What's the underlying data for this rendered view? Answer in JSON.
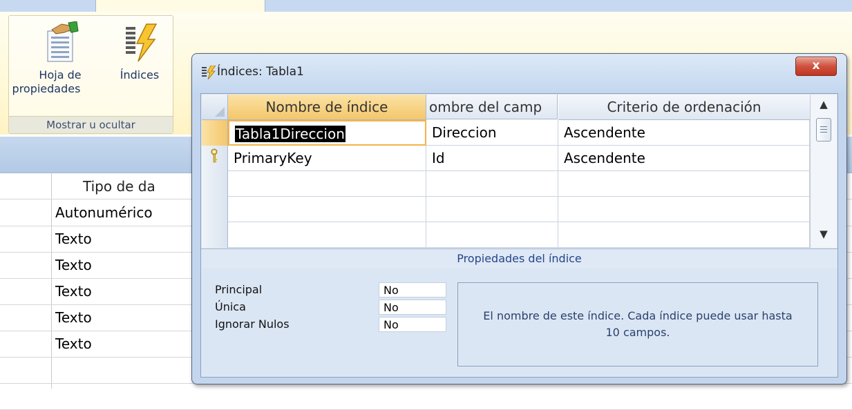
{
  "ribbon": {
    "buttons": [
      {
        "label_line1": "Hoja de",
        "label_line2": "propiedades",
        "icon": "property-sheet-icon"
      },
      {
        "label": "Índices",
        "icon": "indexes-icon"
      }
    ],
    "group_caption": "Mostrar u ocultar"
  },
  "background_table": {
    "column_header": "Tipo de da",
    "rows": [
      "Autonumérico",
      "Texto",
      "Texto",
      "Texto",
      "Texto",
      "Texto",
      "",
      ""
    ]
  },
  "dialog": {
    "title": "Índices: Tabla1",
    "close_label": "x",
    "columns": [
      "Nombre de índice",
      "ombre del camp",
      "Criterio de ordenación"
    ],
    "rows": [
      {
        "index_name": "Tabla1Direccion",
        "field_name": "Direccion",
        "sort_order": "Ascendente",
        "primary_key": false,
        "current": true
      },
      {
        "index_name": "PrimaryKey",
        "field_name": "Id",
        "sort_order": "Ascendente",
        "primary_key": true,
        "current": false
      },
      {
        "index_name": "",
        "field_name": "",
        "sort_order": "",
        "primary_key": false,
        "current": false
      },
      {
        "index_name": "",
        "field_name": "",
        "sort_order": "",
        "primary_key": false,
        "current": false
      },
      {
        "index_name": "",
        "field_name": "",
        "sort_order": "",
        "primary_key": false,
        "current": false
      }
    ],
    "properties_caption": "Propiedades del índice",
    "properties": [
      {
        "label": "Principal",
        "value": "No"
      },
      {
        "label": "Única",
        "value": "No"
      },
      {
        "label": "Ignorar Nulos",
        "value": "No"
      }
    ],
    "help_text": "El nombre de este índice. Cada índice puede usar hasta 10 campos."
  },
  "colors": {
    "selection_highlight": "#f4c66a",
    "ribbon_tab_bg": "#c6d9f1",
    "close_button": "#cf5240"
  }
}
